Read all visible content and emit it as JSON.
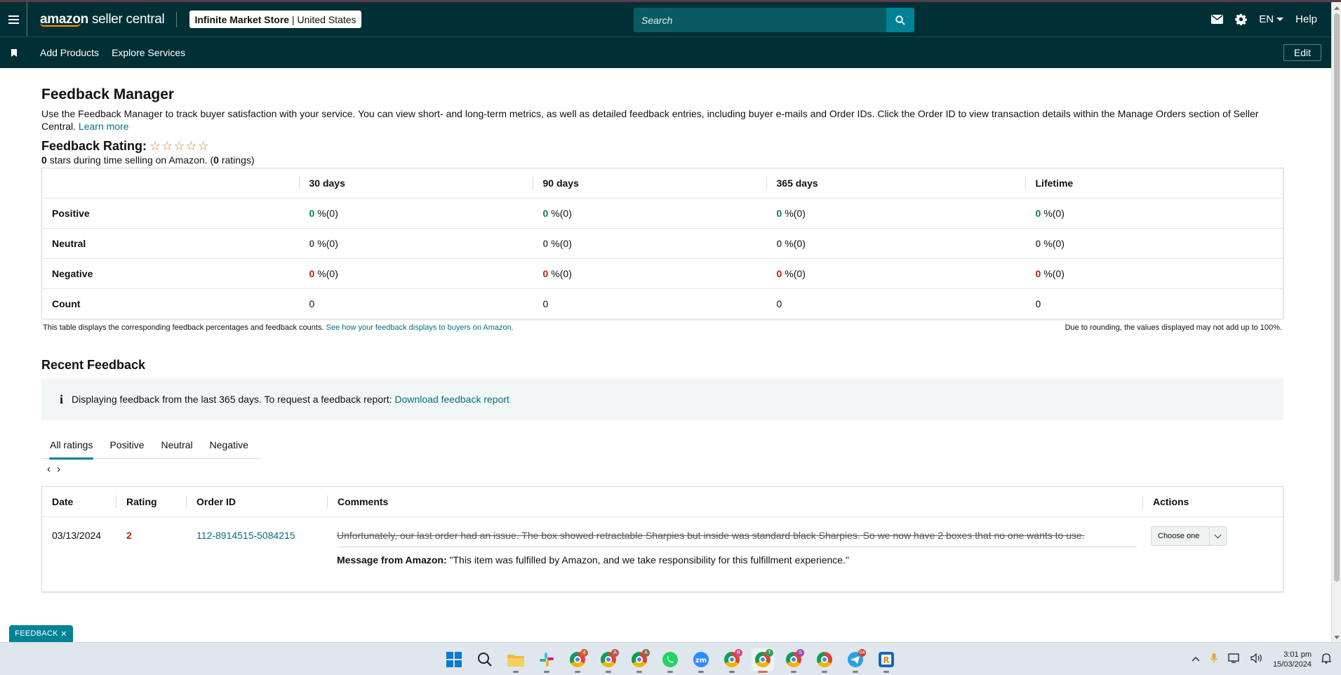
{
  "topbar": {
    "logo_brand": "amazon",
    "logo_product": "seller central",
    "store_name": "Infinite Market Store",
    "store_region": "United States",
    "search_placeholder": "Search",
    "language": "EN",
    "help": "Help",
    "icons": [
      "hamburger-menu-icon",
      "mail-icon",
      "gear-icon",
      "search-icon"
    ]
  },
  "subnav": {
    "items": [
      "Add Products",
      "Explore Services"
    ],
    "edit": "Edit"
  },
  "page": {
    "title": "Feedback Manager",
    "description": "Use the Feedback Manager to track buyer satisfaction with your service. You can view short- and long-term metrics, as well as detailed feedback entries, including buyer e-mails and Order IDs. Click the Order ID to view transaction details within the Manage Orders section of Seller Central.",
    "learn_more": "Learn more",
    "rating_label": "Feedback Rating:",
    "rating_stars": 0,
    "rating_max": 5,
    "stars_count": "0",
    "stars_text": "stars during time selling on Amazon. (",
    "ratings_count": "0",
    "ratings_text": "ratings)"
  },
  "metrics": {
    "columns": [
      "30 days",
      "90 days",
      "365 days",
      "Lifetime"
    ],
    "rows": [
      {
        "label": "Positive",
        "type": "pos",
        "values": [
          {
            "v": "0",
            "rest": "%(0)"
          },
          {
            "v": "0",
            "rest": "%(0)"
          },
          {
            "v": "0",
            "rest": "%(0)"
          },
          {
            "v": "0",
            "rest": "%(0)"
          }
        ]
      },
      {
        "label": "Neutral",
        "type": "neu",
        "values": [
          {
            "v": "0",
            "rest": "%(0)"
          },
          {
            "v": "0",
            "rest": "%(0)"
          },
          {
            "v": "0",
            "rest": "%(0)"
          },
          {
            "v": "0",
            "rest": "%(0)"
          }
        ]
      },
      {
        "label": "Negative",
        "type": "neg",
        "values": [
          {
            "v": "0",
            "rest": "%(0)"
          },
          {
            "v": "0",
            "rest": "%(0)"
          },
          {
            "v": "0",
            "rest": "%(0)"
          },
          {
            "v": "0",
            "rest": "%(0)"
          }
        ]
      },
      {
        "label": "Count",
        "type": "count",
        "values": [
          {
            "v": "0",
            "rest": ""
          },
          {
            "v": "0",
            "rest": ""
          },
          {
            "v": "0",
            "rest": ""
          },
          {
            "v": "0",
            "rest": ""
          }
        ]
      }
    ],
    "note_left": "This table displays the corresponding feedback percentages and feedback counts.",
    "note_link": "See how your feedback displays to buyers on Amazon.",
    "note_right": "Due to rounding, the values displayed may not add up to 100%."
  },
  "recent": {
    "title": "Recent Feedback",
    "info_text": "Displaying feedback from the last 365 days. To request a feedback report:",
    "info_link": "Download feedback report",
    "tabs": [
      "All ratings",
      "Positive",
      "Neutral",
      "Negative"
    ],
    "active_tab": "All ratings",
    "columns": [
      "Date",
      "Rating",
      "Order ID",
      "Comments",
      "Actions"
    ],
    "rows": [
      {
        "date": "03/13/2024",
        "rating": "2",
        "order_id": "112-8914515-5084215",
        "comment": "Unfortunately, our last order had an issue. The box showed retractable Sharpies but inside was standard black Sharpies. So we now have 2 boxes that no one wants to use.",
        "message_label": "Message from Amazon:",
        "message": "\"This item was fulfilled by Amazon, and we take responsibility for this fulfillment experience.\"",
        "action": "Choose one"
      }
    ]
  },
  "feedback_tab": "FEEDBACK",
  "taskbar": {
    "apps": [
      "windows-start-icon",
      "search-icon",
      "file-explorer-icon",
      "slack-icon",
      "chrome-icon",
      "chrome-icon",
      "chrome-icon",
      "whatsapp-icon",
      "zoom-icon",
      "chrome-icon",
      "chrome-icon",
      "chrome-icon",
      "chrome-icon",
      "telegram-icon",
      "app-r-icon"
    ],
    "time": "3:01 pm",
    "date": "15/03/2024"
  }
}
